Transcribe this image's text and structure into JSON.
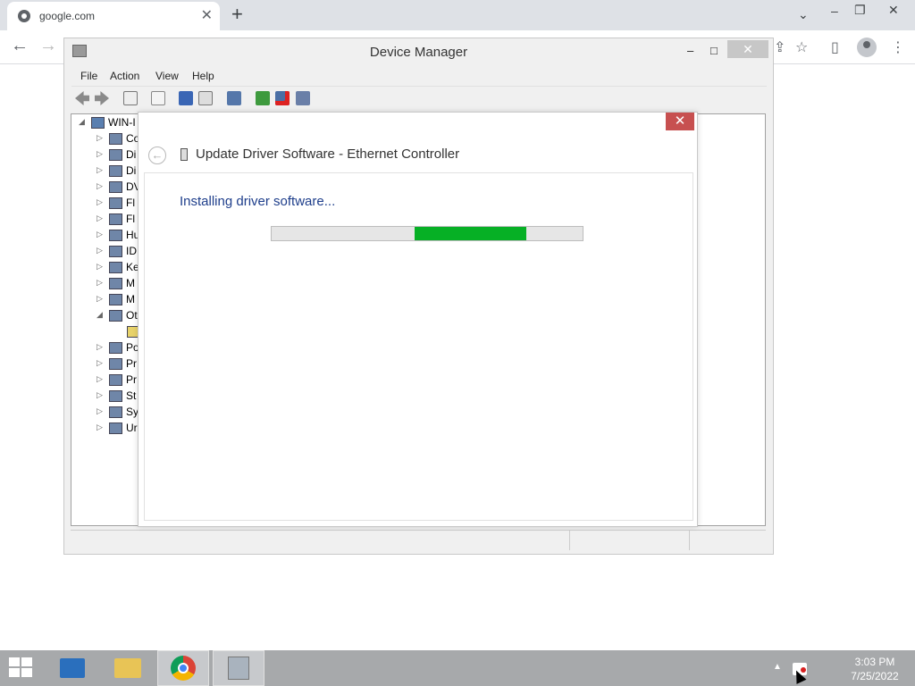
{
  "browser": {
    "tab_title": "google.com",
    "close_tab_glyph": "✕",
    "new_tab_glyph": "+",
    "tab_list_glyph": "⌄",
    "minimize_glyph": "–",
    "restore_glyph": "❐",
    "close_glyph": "✕",
    "back_glyph": "←",
    "forward_glyph": "→",
    "icons": [
      "share-icon",
      "star-icon",
      "side-panel-icon",
      "profile-icon",
      "menu-icon"
    ]
  },
  "device_manager": {
    "title": "Device Manager",
    "menu": [
      "File",
      "Action",
      "View",
      "Help"
    ],
    "controls": {
      "minimize": "–",
      "maximize": "□",
      "close": "✕"
    },
    "tree": {
      "root": "WIN-I",
      "items": [
        {
          "label": "Co",
          "expanded": false
        },
        {
          "label": "Di",
          "expanded": false
        },
        {
          "label": "Di",
          "expanded": false
        },
        {
          "label": "DV",
          "expanded": false
        },
        {
          "label": "Fl",
          "expanded": false
        },
        {
          "label": "Fl",
          "expanded": false
        },
        {
          "label": "Hu",
          "expanded": false
        },
        {
          "label": "ID",
          "expanded": false
        },
        {
          "label": "Ke",
          "expanded": false
        },
        {
          "label": "M",
          "expanded": false
        },
        {
          "label": "M",
          "expanded": false
        },
        {
          "label": "Ot",
          "expanded": true
        },
        {
          "label": "",
          "expanded": false,
          "child": true
        },
        {
          "label": "Po",
          "expanded": false
        },
        {
          "label": "Pr",
          "expanded": false
        },
        {
          "label": "Pr",
          "expanded": false
        },
        {
          "label": "St",
          "expanded": false
        },
        {
          "label": "Sy",
          "expanded": false
        },
        {
          "label": "Ur",
          "expanded": false
        }
      ]
    }
  },
  "dialog": {
    "title": "Update Driver Software - Ethernet Controller",
    "status": "Installing driver software...",
    "close_glyph": "✕",
    "back_glyph": "←",
    "progress_marquee_start": 0.46,
    "progress_marquee_end": 0.82
  },
  "taskbar": {
    "time": "3:03 PM",
    "date": "7/25/2022",
    "apps": [
      "powershell",
      "file-explorer",
      "chrome",
      "device-manager"
    ],
    "tray_arrow": "▲"
  },
  "colors": {
    "progress": "#06b025",
    "dialog_close": "#c75050",
    "status_text": "#1e3e8b",
    "taskbar": "#a7a9ab"
  }
}
